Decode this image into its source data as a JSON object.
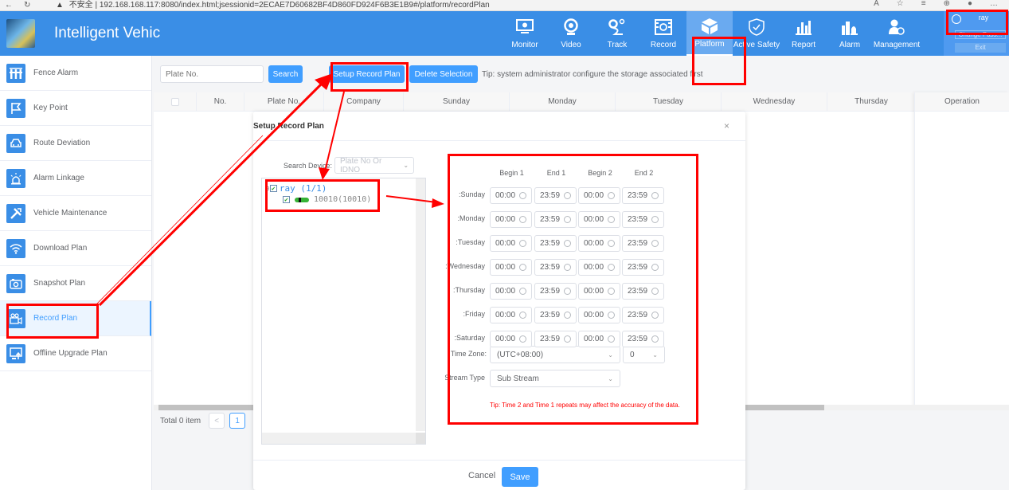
{
  "browser": {
    "security_label": "不安全",
    "url": "192.168.168.117:8080/index.html;jsessionid=2ECAE7D60682BF4D860FD924F6B3E1B9#/platform/recordPlan"
  },
  "header": {
    "app_title": "Intelligent Vehic",
    "nav": [
      {
        "label": "Monitor",
        "icon": "monitor-icon"
      },
      {
        "label": "Video",
        "icon": "camera-icon"
      },
      {
        "label": "Track",
        "icon": "track-icon"
      },
      {
        "label": "Record",
        "icon": "record-icon"
      },
      {
        "label": "Platform",
        "icon": "cube-icon",
        "active": true
      },
      {
        "label": "Active Safety",
        "icon": "shield-icon"
      },
      {
        "label": "Report",
        "icon": "bar-chart-icon"
      },
      {
        "label": "Alarm",
        "icon": "alarm-icon"
      },
      {
        "label": "Management",
        "icon": "user-manage-icon"
      }
    ],
    "user": {
      "name": "ray",
      "change_password": "Change Pass...",
      "exit": "Exit"
    }
  },
  "sidebar": {
    "items": [
      {
        "label": "Fence Alarm",
        "icon": "fence-icon"
      },
      {
        "label": "Key Point",
        "icon": "flag-icon"
      },
      {
        "label": "Route Deviation",
        "icon": "car-icon"
      },
      {
        "label": "Alarm Linkage",
        "icon": "siren-icon"
      },
      {
        "label": "Vehicle Maintenance",
        "icon": "tools-icon"
      },
      {
        "label": "Download Plan",
        "icon": "wifi-icon"
      },
      {
        "label": "Snapshot Plan",
        "icon": "camera-icon"
      },
      {
        "label": "Record Plan",
        "icon": "video-camera-icon",
        "active": true
      },
      {
        "label": "Offline Upgrade Plan",
        "icon": "upgrade-icon"
      }
    ]
  },
  "toolbar": {
    "plate_placeholder": "Plate No.",
    "search_label": "Search",
    "setup_label": "Setup Record Plan",
    "delete_label": "Delete Selection",
    "tip": "Tip: system administrator configure the storage associated first"
  },
  "table": {
    "columns": [
      "",
      "No.",
      "Plate No.",
      "Company",
      "Sunday",
      "Monday",
      "Tuesday",
      "Wednesday",
      "Thursday"
    ],
    "operation_header": "Operation",
    "rows": []
  },
  "pagination": {
    "total_label": "Total 0 item",
    "prev": "<",
    "current_page": "1"
  },
  "modal": {
    "title": "Setup Record Plan",
    "close": "×",
    "search_device_label": "Search Device:",
    "search_device_placeholder": "Plate No Or IDNO",
    "tree": {
      "group": {
        "label": "ray (1/1)",
        "checked": true
      },
      "device": {
        "label": "10010(10010)",
        "checked": true
      }
    },
    "schedule": {
      "columns": [
        "Begin 1",
        "End 1",
        "Begin 2",
        "End 2"
      ],
      "days": [
        {
          "label": "Sunday:",
          "times": [
            "00:00",
            "23:59",
            "00:00",
            "23:59"
          ]
        },
        {
          "label": "Monday:",
          "times": [
            "00:00",
            "23:59",
            "00:00",
            "23:59"
          ]
        },
        {
          "label": "Tuesday:",
          "times": [
            "00:00",
            "23:59",
            "00:00",
            "23:59"
          ]
        },
        {
          "label": "Wednesday:",
          "times": [
            "00:00",
            "23:59",
            "00:00",
            "23:59"
          ]
        },
        {
          "label": "Thursday:",
          "times": [
            "00:00",
            "23:59",
            "00:00",
            "23:59"
          ]
        },
        {
          "label": "Friday:",
          "times": [
            "00:00",
            "23:59",
            "00:00",
            "23:59"
          ]
        },
        {
          "label": "Saturday:",
          "times": [
            "00:00",
            "23:59",
            "00:00",
            "23:59"
          ]
        }
      ],
      "time_zone_label": "Time Zone:",
      "time_zone_value": "(UTC+08:00)",
      "time_zone_offset": "0",
      "stream_type_label": "Stream Type",
      "stream_type_value": "Sub Stream",
      "tip": "Tip: Time 2 and Time 1 repeats may affect the accuracy of the data."
    },
    "cancel_label": "Cancel",
    "save_label": "Save"
  },
  "colors": {
    "header": "#3a8ee6",
    "primary": "#409eff",
    "annotation": "#ff0000"
  }
}
